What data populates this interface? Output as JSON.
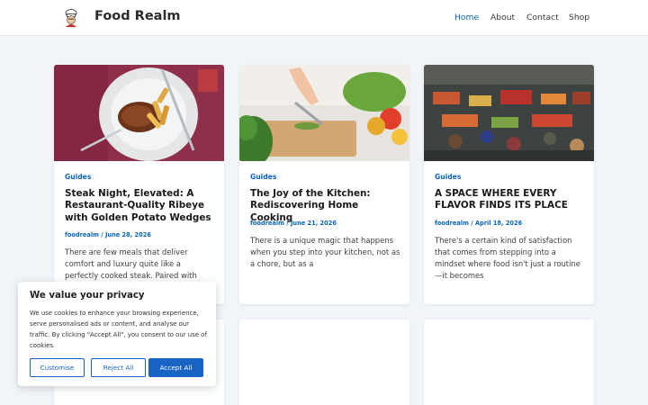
{
  "header": {
    "site_title": "Food Realm",
    "nav": [
      {
        "label": "Home",
        "active": true
      },
      {
        "label": "About",
        "active": false
      },
      {
        "label": "Contact",
        "active": false
      },
      {
        "label": "Shop",
        "active": false
      }
    ]
  },
  "posts": [
    {
      "category": "Guides",
      "title": "Steak Night, Elevated: A Restaurant-Quality Ribeye with Golden Potato Wedges",
      "meta": "foodrealm / June 28, 2026",
      "excerpt": "There are few meals that deliver comfort and luxury quite like a perfectly cooked steak. Paired with crispy golden potato"
    },
    {
      "category": "Guides",
      "title": "The Joy of the Kitchen: Rediscovering Home Cooking",
      "meta": "foodrealm / June 21, 2026",
      "excerpt": "There is a unique magic that happens when you step into your kitchen, not as a chore, but as a"
    },
    {
      "category": "Guides",
      "title": "A SPACE WHERE EVERY FLAVOR FINDS ITS PLACE",
      "meta": "foodrealm / April 18, 2026",
      "excerpt": "There's a certain kind of satisfaction that comes from stepping into a mindset where food isn't just a routine—it becomes"
    }
  ],
  "cookie": {
    "title": "We value your privacy",
    "text": "We use cookies to enhance your browsing experience, serve personalised ads or content, and analyse our traffic. By clicking \"Accept All\", you consent to our use of cookies.",
    "customise": "Customise",
    "reject": "Reject All",
    "accept": "Accept All"
  },
  "colors": {
    "accent": "#0a64c2",
    "page_bg": "#f0f5fa",
    "button": "#1863c4"
  },
  "icons": {
    "logo": "chef-logo-icon"
  }
}
